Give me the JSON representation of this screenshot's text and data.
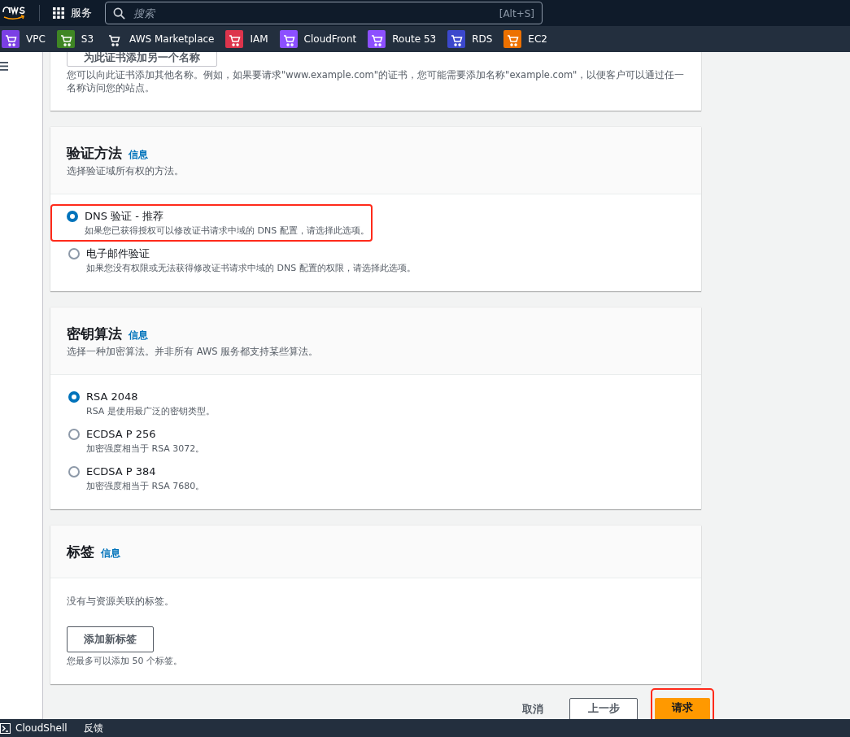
{
  "top_bar": {
    "services_label": "服务",
    "search": {
      "placeholder": "搜索",
      "shortcut": "[Alt+S]"
    }
  },
  "favorites": [
    {
      "label": "VPC",
      "color": "#7b3fe4"
    },
    {
      "label": "S3",
      "color": "#3f8624"
    },
    {
      "label": "AWS Marketplace"
    },
    {
      "label": "IAM",
      "color": "#dd344c"
    },
    {
      "label": "CloudFront",
      "color": "#8c4fff"
    },
    {
      "label": "Route 53",
      "color": "#8c4fff"
    },
    {
      "label": "RDS",
      "color": "#3b48cc"
    },
    {
      "label": "EC2",
      "color": "#ed7100"
    }
  ],
  "names_section": {
    "add_button": "为此证书添加另一个名称",
    "hint": "您可以向此证书添加其他名称。例如，如果要请求\"www.example.com\"的证书，您可能需要添加名称\"example.com\"，以便客户可以通过任一名称访问您的站点。"
  },
  "sections": [
    {
      "title": "验证方法",
      "info": "信息",
      "description": "选择验证域所有权的方法。",
      "options": [
        {
          "label": "DNS 验证 - 推荐",
          "description": "如果您已获得授权可以修改证书请求中域的 DNS 配置，请选择此选项。",
          "selected": true,
          "highlighted": true
        },
        {
          "label": "电子邮件验证",
          "description": "如果您没有权限或无法获得修改证书请求中域的 DNS 配置的权限，请选择此选项。",
          "selected": false,
          "highlighted": false
        }
      ]
    },
    {
      "title": "密钥算法",
      "info": "信息",
      "description": "选择一种加密算法。并非所有 AWS 服务都支持某些算法。",
      "options": [
        {
          "label": "RSA 2048",
          "description": "RSA 是使用最广泛的密钥类型。",
          "selected": true,
          "highlighted": false
        },
        {
          "label": "ECDSA P 256",
          "description": "加密强度相当于 RSA 3072。",
          "selected": false,
          "highlighted": false
        },
        {
          "label": "ECDSA P 384",
          "description": "加密强度相当于 RSA 7680。",
          "selected": false,
          "highlighted": false
        }
      ]
    }
  ],
  "tags_section": {
    "title": "标签",
    "info": "信息",
    "empty_text": "没有与资源关联的标签。",
    "add_button": "添加新标签",
    "limit_text": "您最多可以添加 50 个标签。"
  },
  "actions": {
    "cancel": "取消",
    "previous": "上一步",
    "submit": "请求",
    "submit_highlighted": true
  },
  "footer": {
    "cloudshell": "CloudShell",
    "feedback": "反馈"
  }
}
